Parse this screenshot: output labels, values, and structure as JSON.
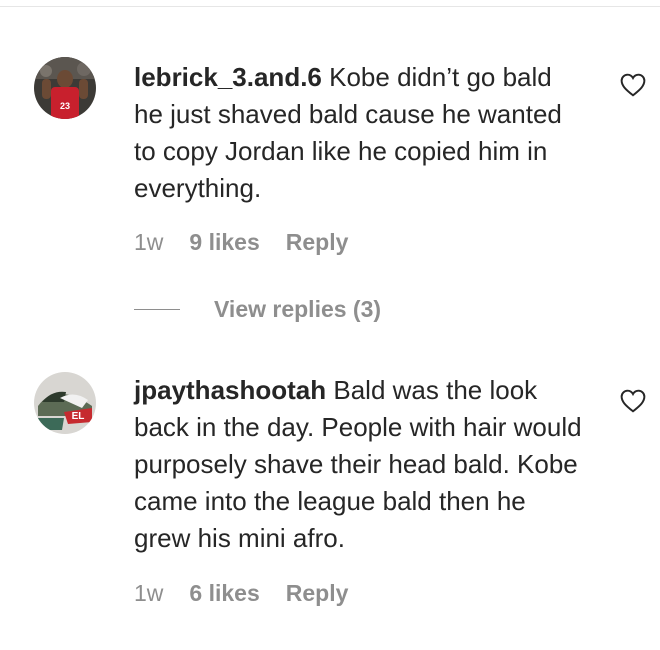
{
  "comments": [
    {
      "username": "lebrick_3.and.6",
      "text": "Kobe didn’t go bald he just shaved bald cause he wanted to copy Jordan like he copied him in everything.",
      "time": "1w",
      "likes": "9 likes",
      "reply": "Reply",
      "avatar_icon": "avatar-basketball-player-red-jersey",
      "view_replies": "View replies (3)"
    },
    {
      "username": "jpaythashootah",
      "text": "Bald was the look back in the day. People with hair would purposely shave their head bald. Kobe came into the league bald then he grew his mini afro.",
      "time": "1w",
      "likes": "6 likes",
      "reply": "Reply",
      "avatar_icon": "avatar-sneakers"
    }
  ],
  "icons": {
    "like": "heart-outline-icon"
  },
  "colors": {
    "text": "#262626",
    "secondary": "#8e8e8e",
    "divider": "#e6e6e6"
  }
}
